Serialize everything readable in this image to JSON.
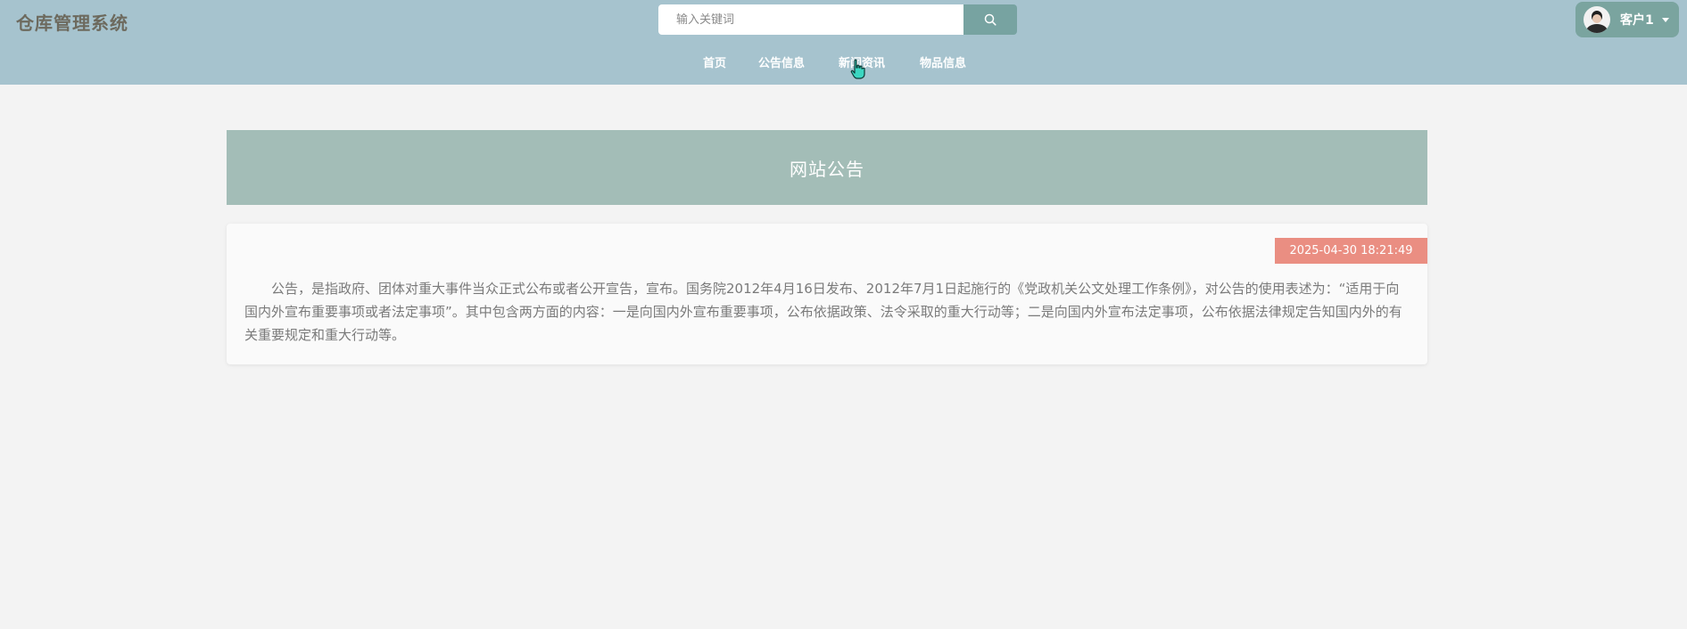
{
  "header": {
    "app_title": "仓库管理系统",
    "bg_color": "#a6c3ce",
    "search": {
      "placeholder": "输入关键词",
      "value": "",
      "button_icon": "search-icon"
    },
    "user": {
      "name": "客户1",
      "avatar_icon": "avatar",
      "dropdown_icon": "caret-down-icon"
    }
  },
  "nav": {
    "items": [
      {
        "label": "首页"
      },
      {
        "label": "公告信息"
      },
      {
        "label": "新闻资讯"
      },
      {
        "label": "物品信息"
      }
    ]
  },
  "main": {
    "banner_title": "网站公告",
    "banner_color": "#a3bdb7",
    "notice": {
      "date": "2025-04-30 18:21:49",
      "date_badge_color": "#ea8e82",
      "content": "公告，是指政府、团体对重大事件当众正式公布或者公开宣告，宣布。国务院2012年4月16日发布、2012年7月1日起施行的《党政机关公文处理工作条例》，对公告的使用表述为：“适用于向国内外宣布重要事项或者法定事项”。其中包含两方面的内容：一是向国内外宣布重要事项，公布依据政策、法令采取的重大行动等；二是向国内外宣布法定事项，公布依据法律规定告知国内外的有关重要规定和重大行动等。"
    }
  }
}
